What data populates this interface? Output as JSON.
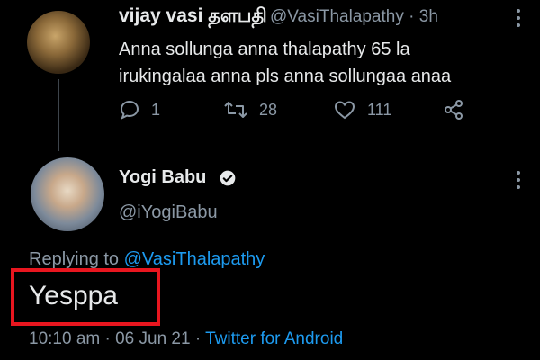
{
  "tweet1": {
    "display_name": "vijay vasi தளபதி",
    "handle": "@VasiThalapathy",
    "age": "· 3h",
    "body": "Anna sollunga anna thalapathy 65 la irukingalaa anna pls anna sollungaa anaa",
    "replies": "1",
    "retweets": "28",
    "likes": "111"
  },
  "tweet2": {
    "display_name": "Yogi Babu",
    "handle": "@iYogiBabu",
    "replying_prefix": "Replying to ",
    "replying_to": "@VasiThalapathy",
    "body": "Yesppa",
    "timestamp": "10:10 am · 06 Jun 21 · ",
    "source": "Twitter for Android"
  },
  "icons": [
    "reply-icon",
    "retweet-icon",
    "like-icon",
    "share-icon",
    "verified-badge-icon",
    "more-icon"
  ],
  "colors": {
    "background": "#000000",
    "link": "#1d9bf0",
    "muted": "#8b98a5",
    "highlight": "#e8161f"
  }
}
